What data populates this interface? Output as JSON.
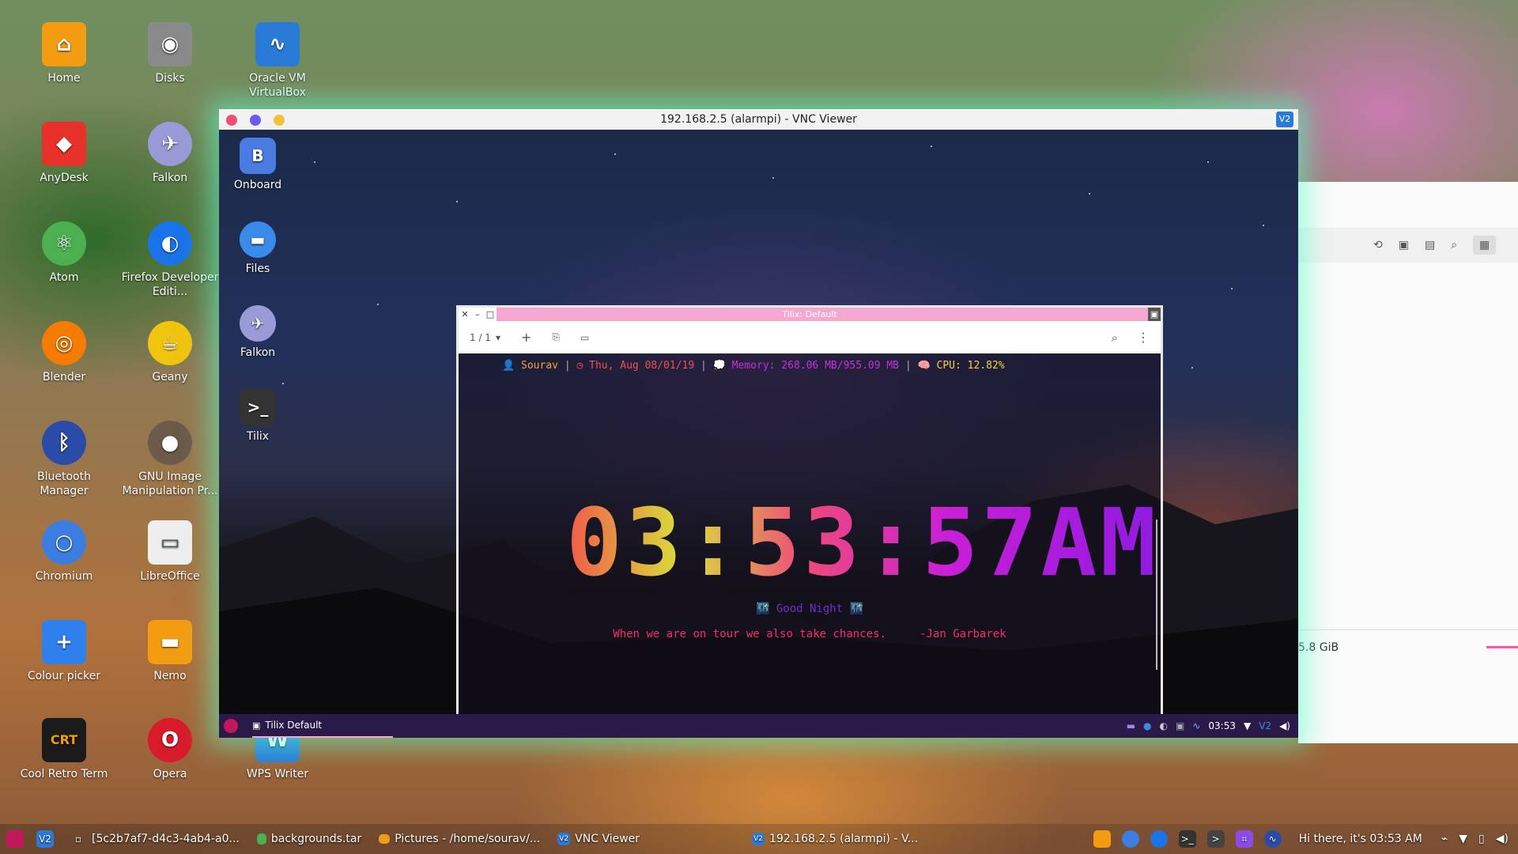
{
  "desktop_icons": [
    {
      "label": "Home",
      "icon": "folder-home-icon",
      "color": "#f39c12"
    },
    {
      "label": "Disks",
      "icon": "disks-icon",
      "color": "#8a8a8a"
    },
    {
      "label": "Oracle VM VirtualBox",
      "icon": "virtualbox-icon",
      "color": "#2a7bd8"
    },
    {
      "label": "AnyDesk",
      "icon": "anydesk-icon",
      "color": "#e8312b"
    },
    {
      "label": "Falkon",
      "icon": "falkon-icon",
      "color": "#9a9ad6"
    },
    {
      "label": "Atom",
      "icon": "atom-icon",
      "color": "#4caf50"
    },
    {
      "label": "Firefox Developer Editi...",
      "icon": "firefox-icon",
      "color": "#1a73e8"
    },
    {
      "label": "Blender",
      "icon": "blender-icon",
      "color": "#f57c00"
    },
    {
      "label": "Geany",
      "icon": "geany-icon",
      "color": "#f1c40f"
    },
    {
      "label": "Bluetooth Manager",
      "icon": "bluetooth-icon",
      "color": "#2a4ba8"
    },
    {
      "label": "GNU Image Manipulation Pr...",
      "icon": "gimp-icon",
      "color": "#6d5a4a"
    },
    {
      "label": "Chromium",
      "icon": "chromium-icon",
      "color": "#3b7de0"
    },
    {
      "label": "LibreOffice",
      "icon": "libreoffice-icon",
      "color": "#eeeeee"
    },
    {
      "label": "Colour picker",
      "icon": "colour-picker-icon",
      "color": "#2f80ed"
    },
    {
      "label": "Nemo",
      "icon": "folder-icon",
      "color": "#f39c12"
    },
    {
      "label": "Cool Retro Term",
      "icon": "cool-retro-term-icon",
      "color": "#1b1b1b"
    },
    {
      "label": "Opera",
      "icon": "opera-icon",
      "color": "#d81b2b"
    },
    {
      "label": "WPS Writer",
      "icon": "wps-writer-icon",
      "color": "#2a7bd8"
    }
  ],
  "vnc": {
    "title": "192.168.2.5 (alarmpi) - VNC Viewer",
    "vnc_badge": "V2"
  },
  "vnc_desktop_icons": [
    {
      "label": "Onboard",
      "icon": "onboard-keyboard-icon"
    },
    {
      "label": "Files",
      "icon": "files-folder-icon"
    },
    {
      "label": "Falkon",
      "icon": "falkon-icon"
    },
    {
      "label": "Tilix",
      "icon": "tilix-terminal-icon"
    }
  ],
  "tilix": {
    "title": "Tilix: Default",
    "session": "1 / 1",
    "status": {
      "user": "Sourav",
      "date": "Thu, Aug 08/01/19",
      "memory": "Memory: 268.06 MB/955.09 MB",
      "cpu": "CPU: 12.82%"
    },
    "clock": "03:53:57AM",
    "greeting": "Good Night",
    "quote": "When we are on tour we also take chances.",
    "quote_author": "-Jan Garbarek"
  },
  "vnc_panel": {
    "task": "Tilix Default",
    "time": "03:53"
  },
  "side_window": {
    "size_text": "5.8 GiB"
  },
  "taskbar": {
    "items": [
      "[5c2b7af7-d4c3-4ab4-a0...",
      "backgrounds.tar",
      "Pictures - /home/sourav/...",
      "VNC Viewer",
      "192.168.2.5 (alarmpi) - V..."
    ],
    "greeting": "Hi there, it's 03:53 AM"
  }
}
